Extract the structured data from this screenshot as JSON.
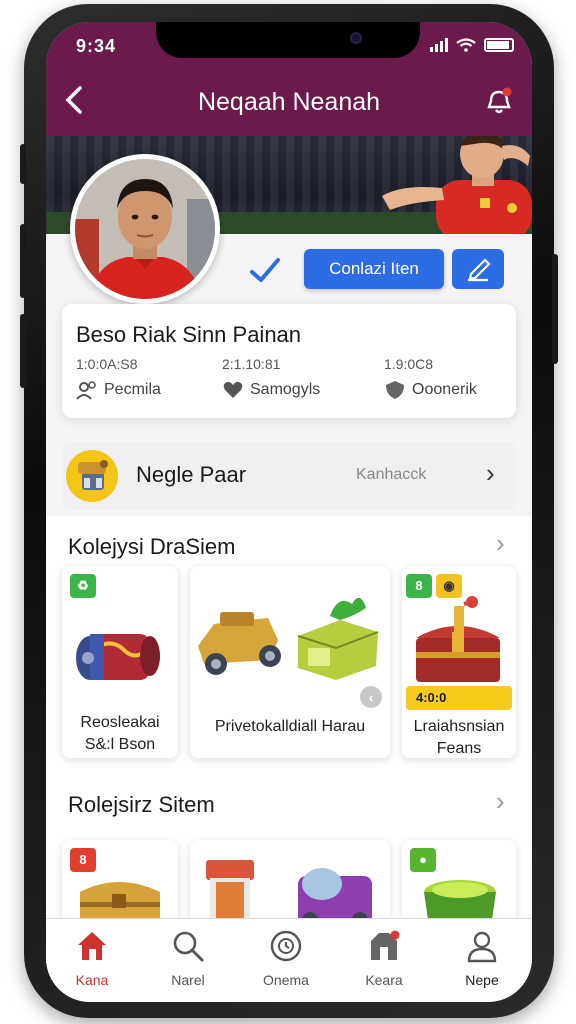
{
  "status": {
    "time": "9:34"
  },
  "header": {
    "back_icon": "back-arrow-icon",
    "title": "Neqaah Neanah",
    "notification_icon": "bell-icon",
    "accent": "#6b1a4b"
  },
  "profile": {
    "name": "Beso Riak Sinn Painan",
    "contact_label": "Conlazi Iten",
    "stats": [
      {
        "value": "1:0:0A:S8",
        "label": "Pecmila",
        "icon": "people-icon"
      },
      {
        "value": "2:1.10:81",
        "label": "Samogyls",
        "icon": "heart-icon"
      },
      {
        "value": "1.9:0C8",
        "label": "Ooonerik",
        "icon": "shield-icon"
      }
    ]
  },
  "promo": {
    "label": "Negle Paar",
    "link": "Kanhacck"
  },
  "sections": [
    {
      "title": "Kolejysi DraSiem",
      "items": [
        {
          "caption": [
            "Reosleakai",
            "S&:l Bson"
          ]
        },
        {
          "caption": [
            "Privetokalldiall Harau"
          ]
        },
        {
          "caption": [
            "Lraiahsnsian",
            "Feans"
          ],
          "price": "4:0:0"
        }
      ]
    },
    {
      "title": "Rolejsirz Sitem"
    }
  ],
  "tabs": [
    {
      "label": "Kana",
      "icon": "home-icon",
      "active": true
    },
    {
      "label": "Narel",
      "icon": "search-icon"
    },
    {
      "label": "Onema",
      "icon": "clock-icon"
    },
    {
      "label": "Keara",
      "icon": "store-icon"
    },
    {
      "label": "Nepe",
      "icon": "user-icon"
    }
  ]
}
